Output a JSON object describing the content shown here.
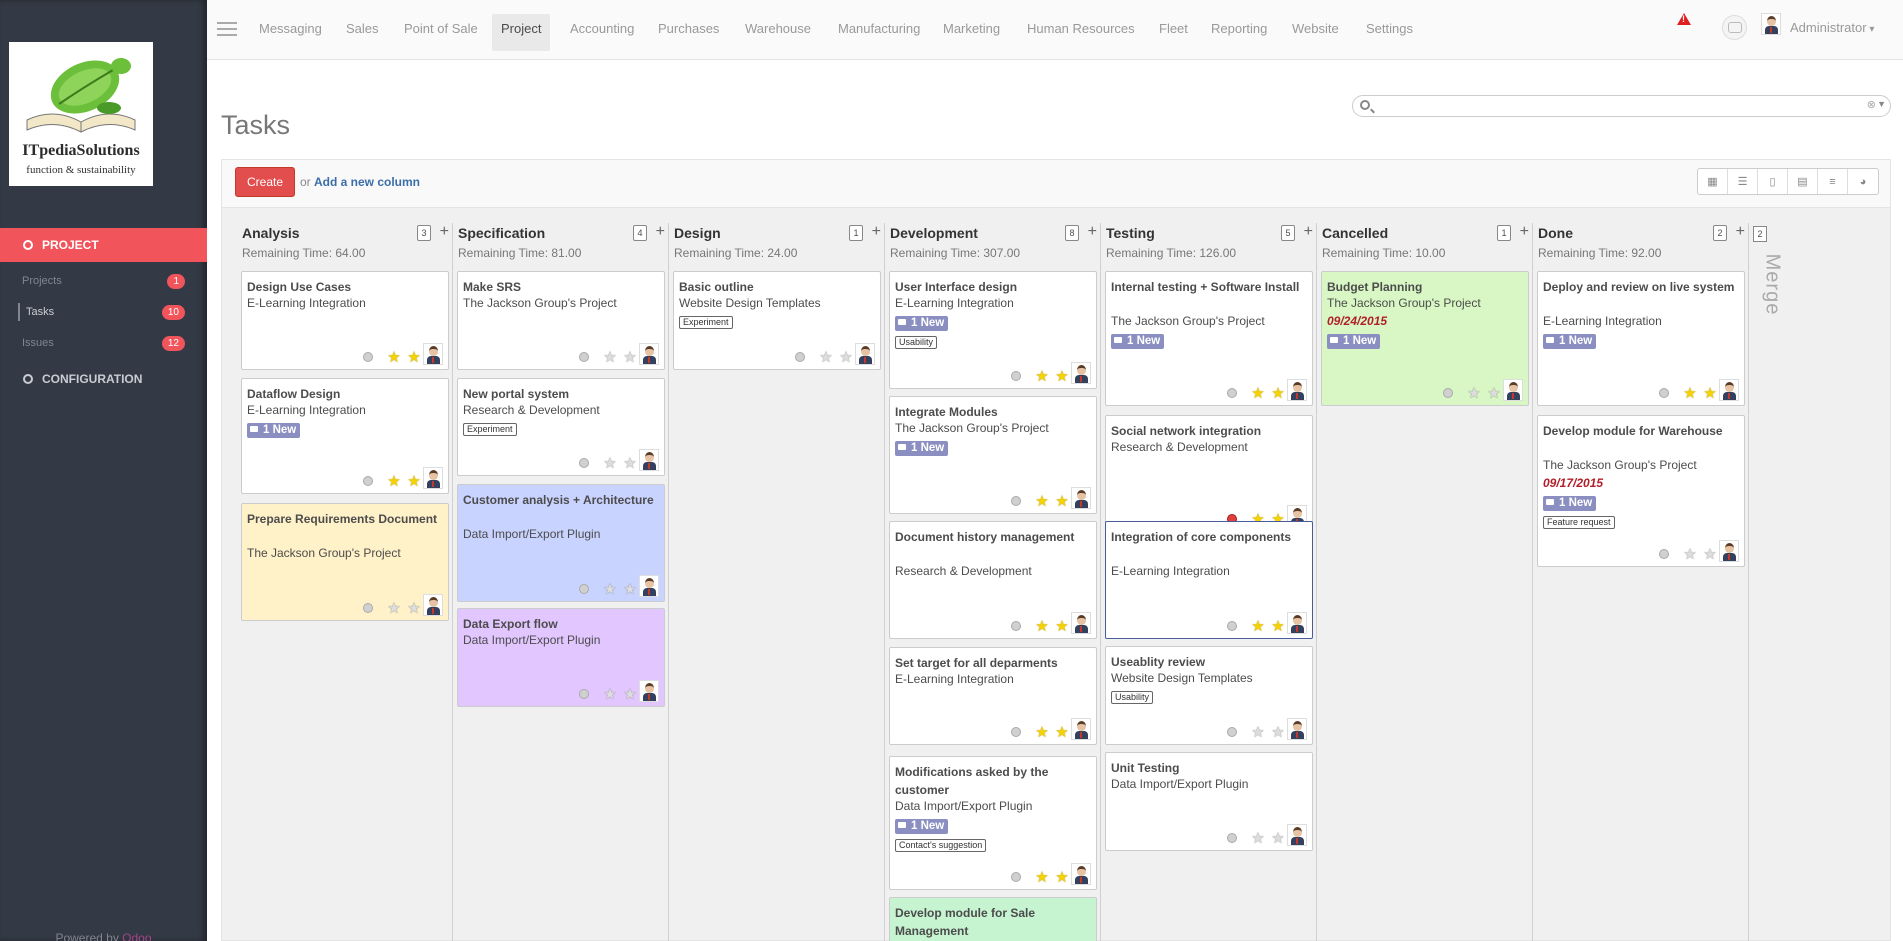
{
  "brand": {
    "name": "ITpediaSolutions",
    "tagline": "function & sustainability",
    "powered_prefix": "Powered by",
    "powered_brand": "Odoo"
  },
  "topnav": [
    "Messaging",
    "Sales",
    "Point of Sale",
    "Project",
    "Accounting",
    "Purchases",
    "Warehouse",
    "Manufacturing",
    "Marketing",
    "Human Resources",
    "Fleet",
    "Reporting",
    "Website",
    "Settings"
  ],
  "user": "Administrator",
  "sidebar": {
    "project_label": "PROJECT",
    "config_label": "CONFIGURATION",
    "items": [
      {
        "label": "Projects",
        "count": "1"
      },
      {
        "label": "Tasks",
        "count": "10"
      },
      {
        "label": "Issues",
        "count": "12"
      }
    ]
  },
  "page": {
    "title": "Tasks",
    "create_label": "Create",
    "or_label": "or",
    "add_column_label": "Add a new column"
  },
  "view_icons": [
    "kanban-icon",
    "list-icon",
    "form-icon",
    "calendar-icon",
    "gantt-icon",
    "graph-icon"
  ],
  "merge": {
    "count": "2",
    "label": "Merge"
  },
  "columns": [
    {
      "title": "Analysis",
      "count": "3",
      "remaining": "Remaining Time: 64.00"
    },
    {
      "title": "Specification",
      "count": "4",
      "remaining": "Remaining Time: 81.00"
    },
    {
      "title": "Design",
      "count": "1",
      "remaining": "Remaining Time: 24.00"
    },
    {
      "title": "Development",
      "count": "8",
      "remaining": "Remaining Time: 307.00"
    },
    {
      "title": "Testing",
      "count": "5",
      "remaining": "Remaining Time: 126.00"
    },
    {
      "title": "Cancelled",
      "count": "1",
      "remaining": "Remaining Time: 10.00"
    },
    {
      "title": "Done",
      "count": "2",
      "remaining": "Remaining Time: 92.00"
    }
  ],
  "cards": [
    {
      "title": "Design Use Cases",
      "project": "E-Learning Integration",
      "stars": 2
    },
    {
      "title": "Dataflow Design",
      "project": "E-Learning Integration",
      "new": "1 New",
      "stars": 2
    },
    {
      "title": "Prepare Requirements Document",
      "project": "The Jackson Group's Project",
      "stars": 0,
      "color": "yellow"
    },
    {
      "title": "Make SRS",
      "project": "The Jackson Group's Project",
      "stars": 0
    },
    {
      "title": "New portal system",
      "project": "Research & Development",
      "tag": "Experiment",
      "stars": 0
    },
    {
      "title": "Customer analysis + Architecture",
      "project": "Data Import/Export Plugin",
      "stars": 0,
      "color": "blue"
    },
    {
      "title": "Data Export flow",
      "project": "Data Import/Export Plugin",
      "stars": 0,
      "color": "purple"
    },
    {
      "title": "Basic outline",
      "project": "Website Design Templates",
      "tag": "Experiment",
      "stars": 0
    },
    {
      "title": "User Interface design",
      "project": "E-Learning Integration",
      "new": "1 New",
      "tag": "Usability",
      "stars": 2
    },
    {
      "title": "Integrate Modules",
      "project": "The Jackson Group's Project",
      "new": "1 New",
      "stars": 2
    },
    {
      "title": "Document history management",
      "project": "Research & Development",
      "stars": 2
    },
    {
      "title": "Set target for all deparments",
      "project": "E-Learning Integration",
      "stars": 2
    },
    {
      "title": "Modifications asked by the customer",
      "project": "Data Import/Export Plugin",
      "new": "1 New",
      "tag": "Contact's suggestion",
      "stars": 2
    },
    {
      "title": "Develop module for Sale Management",
      "color": "mint"
    },
    {
      "title": "Internal testing + Software Install",
      "project": "The Jackson Group's Project",
      "new": "1 New",
      "stars": 2
    },
    {
      "title": "Social network integration",
      "project": "Research & Development",
      "stars": 2,
      "state": "blocked"
    },
    {
      "title": "Integration of core components",
      "project": "E-Learning Integration",
      "stars": 2
    },
    {
      "title": "Useablity review",
      "project": "Website Design Templates",
      "tag": "Usability",
      "stars": 0
    },
    {
      "title": "Unit Testing",
      "project": "Data Import/Export Plugin",
      "stars": 0
    },
    {
      "title": "Budget Planning",
      "project": "The Jackson Group's Project",
      "date": "09/24/2015",
      "new": "1 New",
      "stars": 0,
      "color": "green"
    },
    {
      "title": "Deploy and review on live system",
      "project": "E-Learning Integration",
      "new": "1 New",
      "stars": 2
    },
    {
      "title": "Develop module for Warehouse",
      "project": "The Jackson Group's Project",
      "date": "09/17/2015",
      "new": "1 New",
      "tag": "Feature request",
      "stars": 0
    }
  ]
}
